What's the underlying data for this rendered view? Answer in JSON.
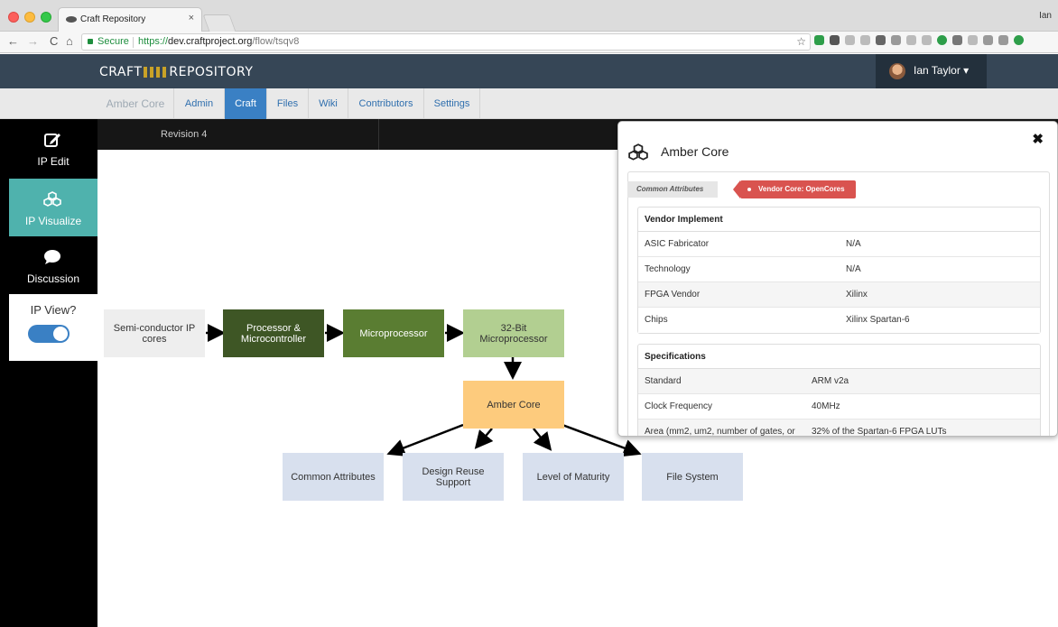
{
  "browser": {
    "tab_title": "Craft Repository",
    "tab_close": "×",
    "user": "Ian",
    "secure_label": "Secure",
    "url_scheme": "https://",
    "url_host": "dev.craftproject.org",
    "url_path": "/flow/tsqv8",
    "nav_back": "←",
    "nav_forward": "→",
    "nav_reload": "C",
    "nav_home": "⌂",
    "star": "☆"
  },
  "app": {
    "logo_left": "CRAFT",
    "logo_right": "REPOSITORY",
    "user_name": "Ian Taylor",
    "user_caret": "▾"
  },
  "subnav": {
    "project": "Amber Core",
    "items": [
      "Admin",
      "Craft",
      "Files",
      "Wiki",
      "Contributors",
      "Settings"
    ],
    "active": "Craft"
  },
  "sidebar": {
    "items": [
      {
        "label": "IP Edit",
        "icon": "edit-icon"
      },
      {
        "label": "IP Visualize",
        "icon": "cubes-icon"
      },
      {
        "label": "Discussion",
        "icon": "chat-icon"
      }
    ],
    "active": "IP Visualize",
    "ip_view_label": "IP View?",
    "ip_view_on": true
  },
  "canvas": {
    "revision": "Revision 4",
    "nodes": {
      "semiconductor": "Semi-conductor IP cores",
      "processor": "Processor & Microcontroller",
      "microprocessor": "Microprocessor",
      "bit32": "32-Bit Microprocessor",
      "amber": "Amber Core",
      "common": "Common Attributes",
      "design": "Design Reuse Support",
      "maturity": "Level of Maturity",
      "filesystem": "File System"
    },
    "colors": {
      "gray": "#eeeeee",
      "dark_green": "#3e5625",
      "mid_green": "#5a7d32",
      "light_green": "#b2cf91",
      "amber": "#fdcb7d",
      "light_blue": "#d8e0ee"
    }
  },
  "panel": {
    "title": "Amber Core",
    "close": "✖",
    "tab_label": "Common Attributes",
    "vendor_badge": "Vendor Core: OpenCores",
    "vendor_section": {
      "title": "Vendor Implement",
      "rows": [
        {
          "k": "ASIC Fabricator",
          "v": "N/A"
        },
        {
          "k": "Technology",
          "v": "N/A"
        },
        {
          "k": "FPGA Vendor",
          "v": "Xilinx"
        },
        {
          "k": "Chips",
          "v": "Xilinx Spartan-6"
        }
      ]
    },
    "spec_section": {
      "title": "Specifications",
      "rows": [
        {
          "k": "Standard",
          "v": "ARM v2a"
        },
        {
          "k": "Clock Frequency",
          "v": "40MHz"
        },
        {
          "k": "Area (mm2, um2, number of gates, or",
          "v": "32% of the Spartan-6 FPGA LUTs"
        }
      ]
    }
  }
}
